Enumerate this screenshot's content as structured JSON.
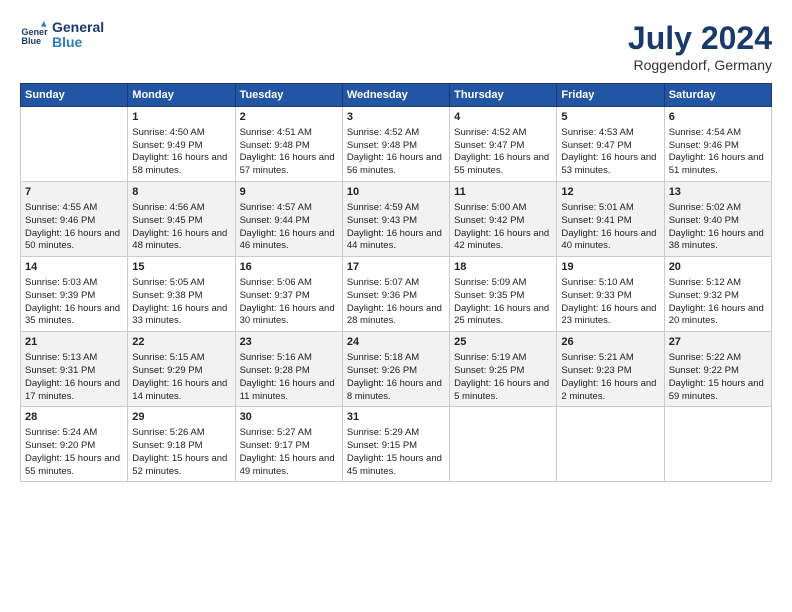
{
  "header": {
    "logo_line1": "General",
    "logo_line2": "Blue",
    "title": "July 2024",
    "subtitle": "Roggendorf, Germany"
  },
  "days": [
    "Sunday",
    "Monday",
    "Tuesday",
    "Wednesday",
    "Thursday",
    "Friday",
    "Saturday"
  ],
  "weeks": [
    [
      {
        "date": "",
        "content": ""
      },
      {
        "date": "1",
        "sunrise": "4:50 AM",
        "sunset": "9:49 PM",
        "daylight": "16 hours and 58 minutes."
      },
      {
        "date": "2",
        "sunrise": "4:51 AM",
        "sunset": "9:48 PM",
        "daylight": "16 hours and 57 minutes."
      },
      {
        "date": "3",
        "sunrise": "4:52 AM",
        "sunset": "9:48 PM",
        "daylight": "16 hours and 56 minutes."
      },
      {
        "date": "4",
        "sunrise": "4:52 AM",
        "sunset": "9:47 PM",
        "daylight": "16 hours and 55 minutes."
      },
      {
        "date": "5",
        "sunrise": "4:53 AM",
        "sunset": "9:47 PM",
        "daylight": "16 hours and 53 minutes."
      },
      {
        "date": "6",
        "sunrise": "4:54 AM",
        "sunset": "9:46 PM",
        "daylight": "16 hours and 51 minutes."
      }
    ],
    [
      {
        "date": "7",
        "sunrise": "4:55 AM",
        "sunset": "9:46 PM",
        "daylight": "16 hours and 50 minutes."
      },
      {
        "date": "8",
        "sunrise": "4:56 AM",
        "sunset": "9:45 PM",
        "daylight": "16 hours and 48 minutes."
      },
      {
        "date": "9",
        "sunrise": "4:57 AM",
        "sunset": "9:44 PM",
        "daylight": "16 hours and 46 minutes."
      },
      {
        "date": "10",
        "sunrise": "4:59 AM",
        "sunset": "9:43 PM",
        "daylight": "16 hours and 44 minutes."
      },
      {
        "date": "11",
        "sunrise": "5:00 AM",
        "sunset": "9:42 PM",
        "daylight": "16 hours and 42 minutes."
      },
      {
        "date": "12",
        "sunrise": "5:01 AM",
        "sunset": "9:41 PM",
        "daylight": "16 hours and 40 minutes."
      },
      {
        "date": "13",
        "sunrise": "5:02 AM",
        "sunset": "9:40 PM",
        "daylight": "16 hours and 38 minutes."
      }
    ],
    [
      {
        "date": "14",
        "sunrise": "5:03 AM",
        "sunset": "9:39 PM",
        "daylight": "16 hours and 35 minutes."
      },
      {
        "date": "15",
        "sunrise": "5:05 AM",
        "sunset": "9:38 PM",
        "daylight": "16 hours and 33 minutes."
      },
      {
        "date": "16",
        "sunrise": "5:06 AM",
        "sunset": "9:37 PM",
        "daylight": "16 hours and 30 minutes."
      },
      {
        "date": "17",
        "sunrise": "5:07 AM",
        "sunset": "9:36 PM",
        "daylight": "16 hours and 28 minutes."
      },
      {
        "date": "18",
        "sunrise": "5:09 AM",
        "sunset": "9:35 PM",
        "daylight": "16 hours and 25 minutes."
      },
      {
        "date": "19",
        "sunrise": "5:10 AM",
        "sunset": "9:33 PM",
        "daylight": "16 hours and 23 minutes."
      },
      {
        "date": "20",
        "sunrise": "5:12 AM",
        "sunset": "9:32 PM",
        "daylight": "16 hours and 20 minutes."
      }
    ],
    [
      {
        "date": "21",
        "sunrise": "5:13 AM",
        "sunset": "9:31 PM",
        "daylight": "16 hours and 17 minutes."
      },
      {
        "date": "22",
        "sunrise": "5:15 AM",
        "sunset": "9:29 PM",
        "daylight": "16 hours and 14 minutes."
      },
      {
        "date": "23",
        "sunrise": "5:16 AM",
        "sunset": "9:28 PM",
        "daylight": "16 hours and 11 minutes."
      },
      {
        "date": "24",
        "sunrise": "5:18 AM",
        "sunset": "9:26 PM",
        "daylight": "16 hours and 8 minutes."
      },
      {
        "date": "25",
        "sunrise": "5:19 AM",
        "sunset": "9:25 PM",
        "daylight": "16 hours and 5 minutes."
      },
      {
        "date": "26",
        "sunrise": "5:21 AM",
        "sunset": "9:23 PM",
        "daylight": "16 hours and 2 minutes."
      },
      {
        "date": "27",
        "sunrise": "5:22 AM",
        "sunset": "9:22 PM",
        "daylight": "15 hours and 59 minutes."
      }
    ],
    [
      {
        "date": "28",
        "sunrise": "5:24 AM",
        "sunset": "9:20 PM",
        "daylight": "15 hours and 55 minutes."
      },
      {
        "date": "29",
        "sunrise": "5:26 AM",
        "sunset": "9:18 PM",
        "daylight": "15 hours and 52 minutes."
      },
      {
        "date": "30",
        "sunrise": "5:27 AM",
        "sunset": "9:17 PM",
        "daylight": "15 hours and 49 minutes."
      },
      {
        "date": "31",
        "sunrise": "5:29 AM",
        "sunset": "9:15 PM",
        "daylight": "15 hours and 45 minutes."
      },
      {
        "date": "",
        "content": ""
      },
      {
        "date": "",
        "content": ""
      },
      {
        "date": "",
        "content": ""
      }
    ]
  ]
}
